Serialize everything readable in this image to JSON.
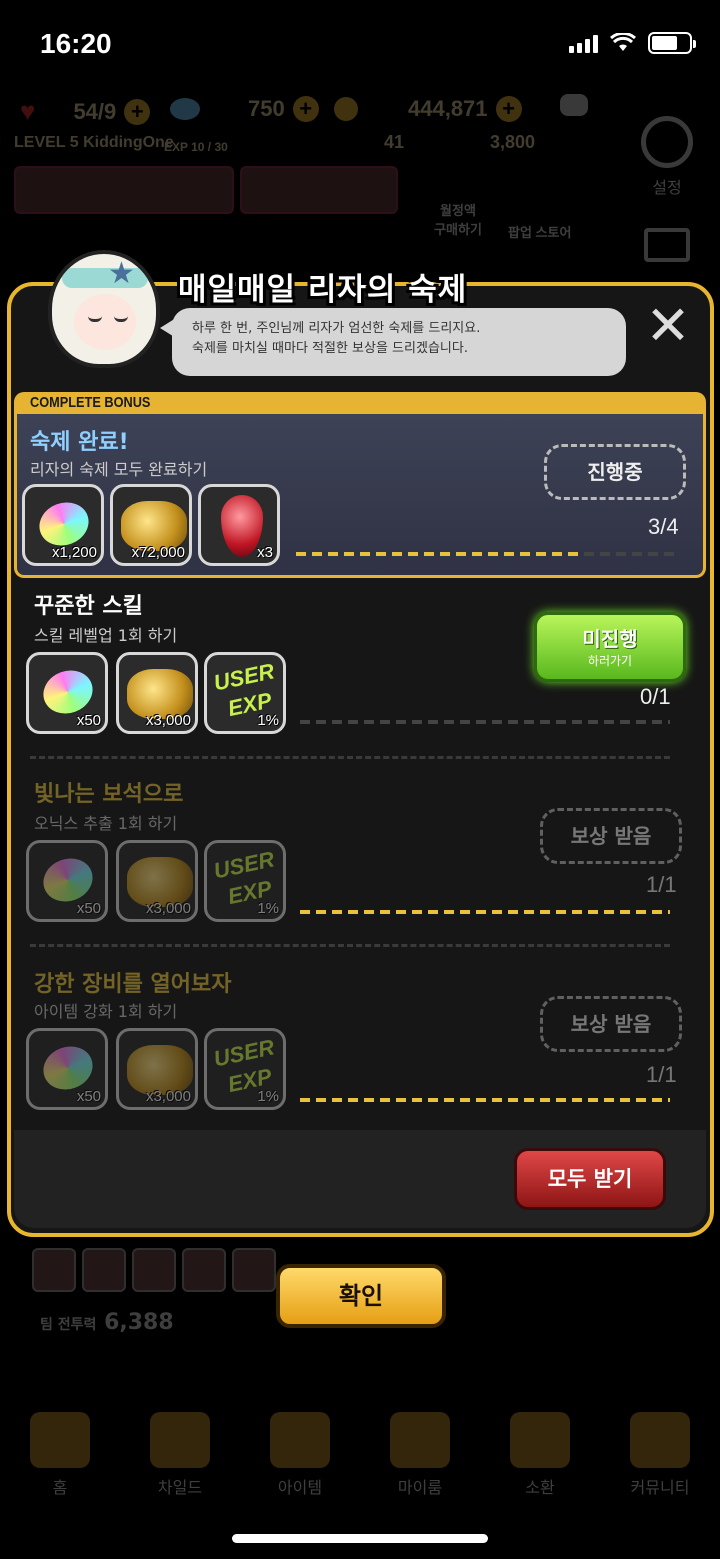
{
  "status_bar": {
    "time": "16:20"
  },
  "background": {
    "hearts": "54/9",
    "gems": "750",
    "gold": "444,871",
    "player_level": "LEVEL 5 KiddingOne",
    "exp": "EXP 10 / 30",
    "res2": "41",
    "res3": "3,800",
    "settings_label": "설정",
    "monthly_label": "월정액\n구매하기",
    "popup_label": "팝업 스토어",
    "team_power_label": "팀 전투력",
    "team_power_value": "6,388",
    "nav": [
      "홈",
      "차일드",
      "아이템",
      "마이룸",
      "소환",
      "커뮤니티"
    ]
  },
  "modal": {
    "title": "매일매일 리자의 숙제",
    "speech_line1": "하루 한 번, 주인님께 리자가 엄선한 숙제를 드리지요.",
    "speech_line2": "숙제를 마치실 때마다 적절한 보상을 드리겠습니다.",
    "close_symbol": "✕",
    "bonus_tab": "COMPLETE BONUS",
    "bonus": {
      "title": "숙제 완료!",
      "desc": "리자의 숙제 모두 완료하기",
      "status": "진행중",
      "progress": "3/4",
      "progress_fraction": 0.75,
      "rewards": [
        {
          "icon": "gem-icon",
          "qty": "x1,200"
        },
        {
          "icon": "gold-coins-icon",
          "qty": "x72,000"
        },
        {
          "icon": "ruby-icon",
          "qty": "x3"
        }
      ]
    },
    "quests": [
      {
        "title": "꾸준한 스킬",
        "desc": "스킬 레벨업 1회 하기",
        "status": "미진행",
        "status_sub": "하러가기",
        "progress": "0/1",
        "progress_fraction": 0,
        "rewards": [
          {
            "icon": "gem-icon",
            "qty": "x50"
          },
          {
            "icon": "gold-coins-icon",
            "qty": "x3,000"
          },
          {
            "icon": "user-exp-icon",
            "qty": "1%"
          }
        ]
      },
      {
        "title": "빛나는 보석으로",
        "desc": "오닉스 추출 1회 하기",
        "status": "보상 받음",
        "progress": "1/1",
        "progress_fraction": 1,
        "rewards": [
          {
            "icon": "gem-icon",
            "qty": "x50"
          },
          {
            "icon": "gold-coins-icon",
            "qty": "x3,000"
          },
          {
            "icon": "user-exp-icon",
            "qty": "1%"
          }
        ]
      },
      {
        "title": "강한 장비를 열어보자",
        "desc": "아이템 강화 1회 하기",
        "status": "보상 받음",
        "progress": "1/1",
        "progress_fraction": 1,
        "rewards": [
          {
            "icon": "gem-icon",
            "qty": "x50"
          },
          {
            "icon": "gold-coins-icon",
            "qty": "x3,000"
          },
          {
            "icon": "user-exp-icon",
            "qty": "1%"
          }
        ]
      }
    ],
    "exp_icon_text": "USER EXP",
    "claim_all": "모두 받기",
    "confirm": "확인"
  },
  "colors": {
    "accent": "#e6b432",
    "green": "#7ddc2e",
    "red": "#c42626"
  }
}
